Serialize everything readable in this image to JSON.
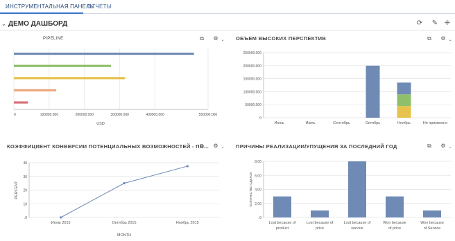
{
  "tabs": [
    {
      "label": "ИНСТРУМЕНТАЛЬНАЯ ПАНЕЛЬ",
      "active": true
    },
    {
      "label": "ОТЧЕТЫ",
      "active": false
    }
  ],
  "dashboard": {
    "title": "ДЕМО ДАШБОРД"
  },
  "panels": {
    "pipeline": {
      "title": "PIPELINE"
    },
    "prospects": {
      "title": "ОБЪЕМ ВЫСОКИХ ПЕРСПЕКТИВ"
    },
    "conversion": {
      "title": "КОЭФФИЦИЕНТ КОНВЕРСИИ ПОТЕНЦИАЛЬНЫХ ВОЗМОЖНОСТЕЙ - ПО..."
    },
    "reasons": {
      "title": "ПРИЧИНЫ РЕАЛИЗАЦИИ/УПУЩЕНИЯ ЗА ПОСЛЕДНИЙ ГОД"
    }
  },
  "chart_data": [
    {
      "type": "bar",
      "orientation": "horizontal",
      "title": "PIPELINE",
      "xlabel": "USD",
      "x_ticks": [
        "0",
        "100000.000",
        "200000.000",
        "300000.000",
        "400000.000",
        "550000.000"
      ],
      "xlim": [
        0,
        550000
      ],
      "series": [
        {
          "value": 510000,
          "color": "#6f8ab5"
        },
        {
          "value": 275000,
          "color": "#8fbf6a"
        },
        {
          "value": 315000,
          "color": "#e7c24c"
        },
        {
          "value": 120000,
          "color": "#eda77d"
        },
        {
          "value": 40000,
          "color": "#d9707a"
        }
      ],
      "grid": true
    },
    {
      "type": "bar",
      "stacked": true,
      "title": "ОБЪЕМ ВЫСОКИХ ПЕРСПЕКТИВ",
      "categories": [
        "Июнь",
        "Июль",
        "Сентябрь",
        "Октябрь",
        "Ноябрь",
        "Не присвоено"
      ],
      "y_ticks": [
        "0",
        "50000.000",
        "100000.000",
        "150000.000",
        "200000.000",
        "250000.000"
      ],
      "ylim": [
        0,
        250000
      ],
      "series": [
        {
          "color": "#e7c24c",
          "values": [
            0,
            0,
            0,
            0,
            45000,
            0
          ]
        },
        {
          "color": "#8fbf6a",
          "values": [
            0,
            0,
            0,
            0,
            45000,
            0
          ]
        },
        {
          "color": "#6f8ab5",
          "values": [
            0,
            0,
            0,
            200000,
            45000,
            0
          ]
        }
      ],
      "grid": true
    },
    {
      "type": "line",
      "title": "КОЭФФИЦИЕНТ КОНВЕРСИИ ПОТЕНЦИАЛЬНЫХ ВОЗМОЖНОСТЕЙ - ПО...",
      "xlabel": "MONTH",
      "ylabel": "PERCENT",
      "categories": [
        "Июль 2015",
        "Октябрь 2015",
        "Ноябрь 2015"
      ],
      "y_ticks": [
        ".0",
        "10",
        "20",
        "30",
        "40"
      ],
      "ylim": [
        0,
        40
      ],
      "values": [
        0,
        25,
        37.5
      ],
      "color": "#6f8ab5",
      "grid": true
    },
    {
      "type": "bar",
      "title": "ПРИЧИНЫ РЕАЛИЗАЦИИ/УПУЩЕНИЯ ЗА ПОСЛЕДНИЙ ГОД",
      "ylabel": "КОЛИЧЕСТВО СДЕЛОК",
      "categories": [
        [
          "Lost because of",
          "product"
        ],
        [
          "Lost because of",
          "price"
        ],
        [
          "Lost because of",
          "service"
        ],
        [
          "Won because",
          "of price"
        ],
        [
          "Won because",
          "of Service"
        ]
      ],
      "y_ticks": [
        ".0",
        "2,00",
        "4,00",
        "6,00",
        "8,00"
      ],
      "ylim": [
        0,
        8
      ],
      "values": [
        3,
        1,
        8,
        3,
        1
      ],
      "color": "#6f8ab5",
      "grid": true
    }
  ]
}
